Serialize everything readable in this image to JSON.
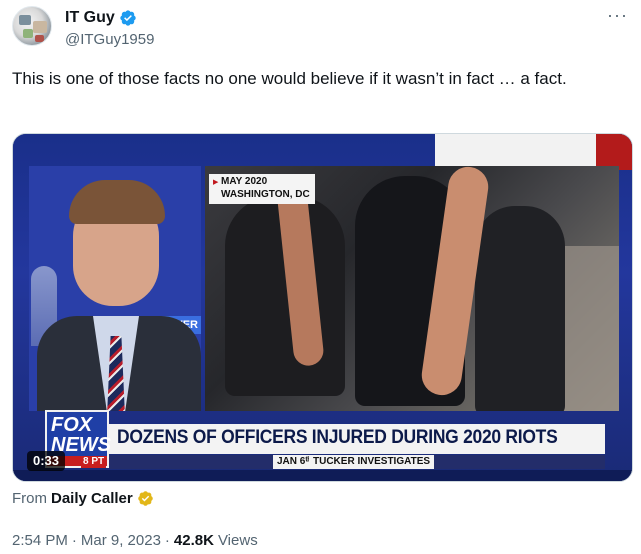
{
  "author": {
    "display_name": "IT Guy",
    "handle": "@ITGuy1959",
    "verified_icon": "verified-badge-icon",
    "verified_color": "#1d9bf0"
  },
  "more_icon": "more-options-icon",
  "tweet": {
    "text": "This is one of those facts no one would believe if it wasn’t in fact … a fact."
  },
  "media": {
    "location_date": "MAY 2020",
    "location_place": "WASHINGTON, DC",
    "sign_text": "VER",
    "headline": "DOZENS OF OFFICERS INJURED DURING 2020 RIOTS",
    "sub_tag_date": "JAN 6ᵗʰ",
    "sub_tag_show": "TUCKER INVESTIGATES",
    "logo_top": "FOX",
    "logo_bottom": "NEWS",
    "time_small": "8 PT",
    "duration": "0:33"
  },
  "source": {
    "label": "From",
    "name": "Daily Caller",
    "badge_icon": "gold-verified-badge-icon",
    "badge_color": "#e2b719"
  },
  "meta": {
    "time": "2:54 PM",
    "separator1": "·",
    "date": "Mar 9, 2023",
    "separator2": "·",
    "views_count": "42.8K",
    "views_label": "Views"
  }
}
